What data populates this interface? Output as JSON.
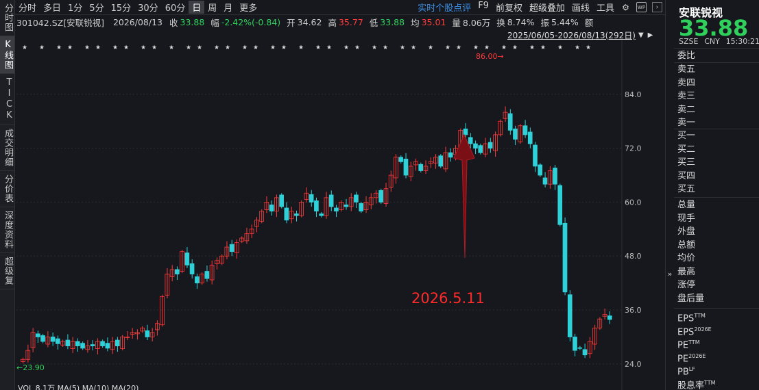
{
  "nav": [
    "分时图",
    "K线图",
    "TICK",
    "成交明细",
    "分价表",
    "深度资料",
    "超级复"
  ],
  "toolbar": {
    "timeframes": [
      "分时",
      "多日",
      "1分",
      "5分",
      "15分",
      "30分",
      "60分",
      "日",
      "周",
      "月",
      "更多"
    ],
    "right_items": [
      "实时个股点评",
      "F9",
      "前复权",
      "超级叠加",
      "画线",
      "工具"
    ],
    "icons": [
      "gear-icon",
      "wp-icon",
      "nav-right-icon"
    ]
  },
  "quote": {
    "code": "301042.SZ[安联锐视]",
    "date": "2026/08/13",
    "close_label": "收",
    "close": "33.88",
    "change_label": "幅",
    "change": "-2.42%(-0.84)",
    "open_label": "开",
    "open": "34.62",
    "high_label": "高",
    "high": "35.77",
    "low_label": "低",
    "low": "33.88",
    "avg_label": "均",
    "avg": "35.01",
    "vol_label": "量",
    "vol": "8.06万",
    "turnover_label": "换",
    "turnover": "8.74%",
    "amp_label": "振",
    "amp": "5.44%",
    "amt_label": "额"
  },
  "range": "2025/06/05-2026/08/13(292日)",
  "chart_data": {
    "type": "candlestick",
    "y_ticks": [
      "84.0",
      "72.0",
      "60.0",
      "48.0",
      "36.0",
      "24.0"
    ],
    "ylim": [
      22,
      96
    ],
    "max_label": "86.00",
    "min_label": "23.90",
    "annotation": "2026.5.11",
    "closes": [
      25,
      27,
      31,
      30,
      29,
      30,
      29,
      28.5,
      29,
      28,
      29,
      28,
      27.5,
      28,
      28,
      29,
      28,
      27.5,
      29,
      28,
      30,
      30,
      31,
      31,
      32,
      30,
      31,
      33,
      39,
      44,
      45,
      44,
      49,
      46,
      44,
      42,
      44,
      43,
      46,
      47,
      48,
      50,
      49,
      51,
      52,
      53,
      54,
      56,
      58,
      60,
      58,
      61,
      59,
      56,
      58,
      57,
      60,
      62,
      60,
      58,
      57,
      61,
      59,
      58,
      60,
      59,
      61,
      60,
      58,
      60,
      61,
      62,
      60,
      63,
      66,
      70,
      69,
      66,
      68,
      69,
      67,
      68,
      69,
      70,
      68,
      71,
      70,
      72,
      76,
      75,
      73,
      72,
      71,
      73,
      72,
      75,
      78,
      80,
      76,
      74,
      77,
      75,
      73,
      68,
      66,
      64,
      67,
      64,
      55,
      40,
      30,
      27,
      27.5,
      26,
      29,
      32,
      34,
      35,
      33.88
    ],
    "volume_label": "VOL",
    "volume_value": "8.1万",
    "ma_labels": [
      "MA(5)",
      "MA(10)",
      "MA(20)"
    ]
  },
  "right": {
    "name": "安联锐视",
    "price": "33.88",
    "exchange": "SZSE",
    "currency": "CNY",
    "time": "15:30:21",
    "ratio_label": "委比",
    "sells": [
      "卖五",
      "卖四",
      "卖三",
      "卖二",
      "卖一"
    ],
    "buys": [
      "买一",
      "买二",
      "买三",
      "买四",
      "买五"
    ],
    "stats": [
      "总量",
      "现手",
      "外盘",
      "总额",
      "均价",
      "最高",
      "涨停",
      "盘后量"
    ],
    "fin": [
      "EPS",
      "EPS",
      "PE",
      "PE",
      "PB",
      "股息率"
    ],
    "fin_sup": [
      "TTM",
      "2026E",
      "TTM",
      "2026E",
      "LF",
      "TTM"
    ]
  },
  "colors": {
    "up": "#ff3b3b",
    "down": "#2fd1d8",
    "accent": "#3a8ee6",
    "price": "#2fd15c"
  }
}
